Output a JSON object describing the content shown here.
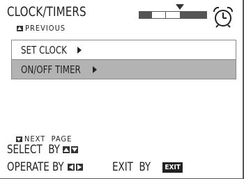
{
  "header": {
    "title": "CLOCK/TIMERS",
    "previous_label": "PREVIOUS",
    "level_segments": [
      1,
      0,
      0,
      1,
      1
    ],
    "icon": "alarm-clock-icon"
  },
  "menu": {
    "items": [
      {
        "label": "SET CLOCK",
        "selected": false
      },
      {
        "label": "ON/OFF TIMER",
        "selected": true
      }
    ]
  },
  "footer": {
    "next_page_label": "NEXT  PAGE",
    "select_label": "SELECT  BY",
    "operate_label": "OPERATE BY",
    "exit_label": "EXIT  BY",
    "exit_key": "EXIT"
  },
  "colors": {
    "selected_item": "#b3b3b3",
    "text": "#222222",
    "background": "#ffffff"
  }
}
